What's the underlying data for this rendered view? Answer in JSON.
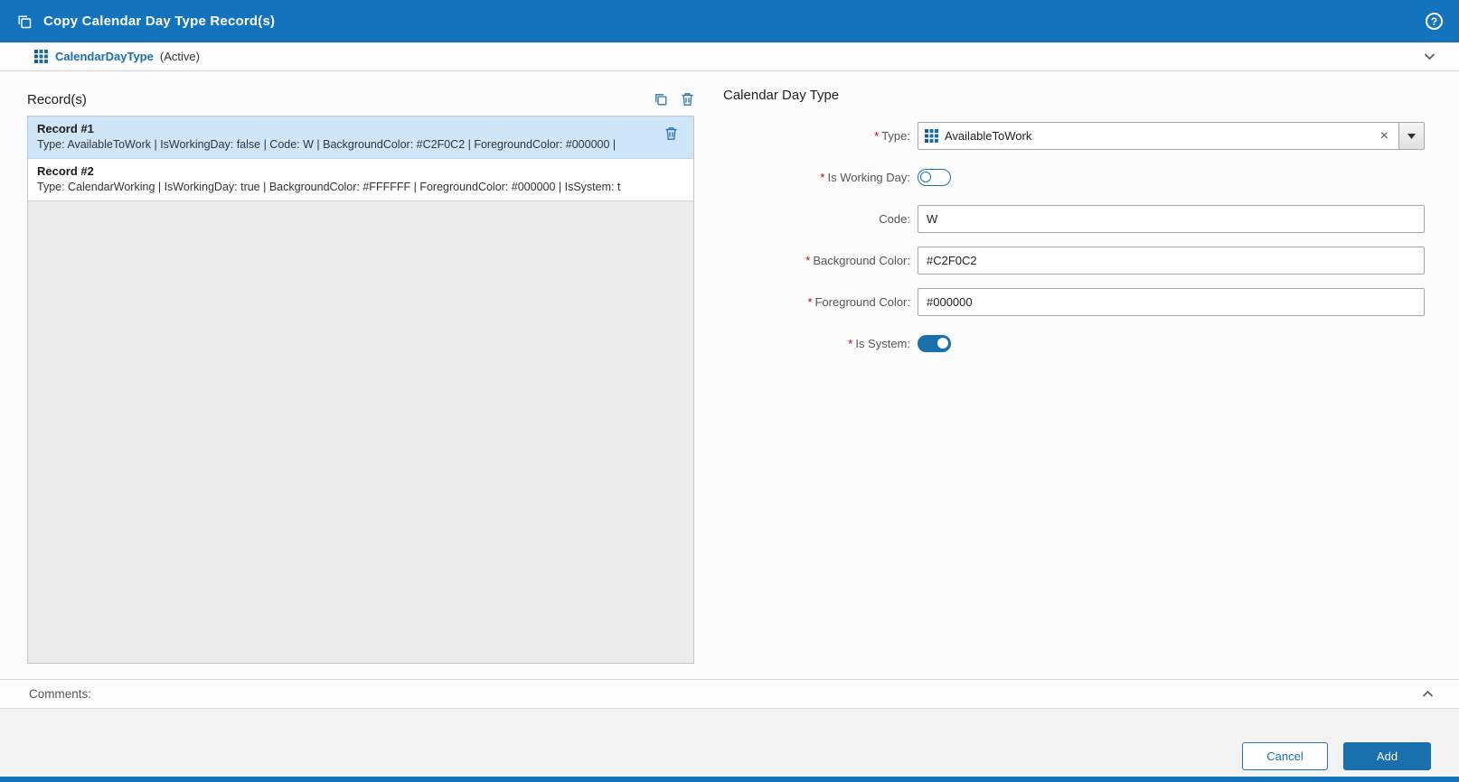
{
  "ui": {
    "required_marker": "*",
    "clear_glyph": "×",
    "help_glyph": "?"
  },
  "colors": {
    "header_blue": "#1373bd",
    "accent_blue": "#1a6fad",
    "selected_row": "#cfe6f8",
    "required_red": "#c00000"
  },
  "header": {
    "title": "Copy Calendar Day Type Record(s)"
  },
  "entity_bar": {
    "name": "CalendarDayType",
    "status": "(Active)"
  },
  "records_panel": {
    "title": "Record(s)",
    "records": [
      {
        "name": "Record #1",
        "details": "Type: AvailableToWork | IsWorkingDay: false | Code: W | BackgroundColor: #C2F0C2 | ForegroundColor: #000000 |",
        "selected": true
      },
      {
        "name": "Record #2",
        "details": "Type: CalendarWorking | IsWorkingDay: true | BackgroundColor: #FFFFFF | ForegroundColor: #000000 | IsSystem: t",
        "selected": false
      }
    ]
  },
  "form": {
    "title": "Calendar Day Type",
    "fields": {
      "type": {
        "label": "Type:",
        "required": true,
        "value": "AvailableToWork"
      },
      "is_working_day": {
        "label": "Is Working Day:",
        "required": true,
        "value": false
      },
      "code": {
        "label": "Code:",
        "required": false,
        "value": "W"
      },
      "background_color": {
        "label": "Background Color:",
        "required": true,
        "value": "#C2F0C2"
      },
      "foreground_color": {
        "label": "Foreground Color:",
        "required": true,
        "value": "#000000"
      },
      "is_system": {
        "label": "Is System:",
        "required": true,
        "value": true
      }
    }
  },
  "comments": {
    "label": "Comments:"
  },
  "footer": {
    "cancel_label": "Cancel",
    "add_label": "Add"
  }
}
